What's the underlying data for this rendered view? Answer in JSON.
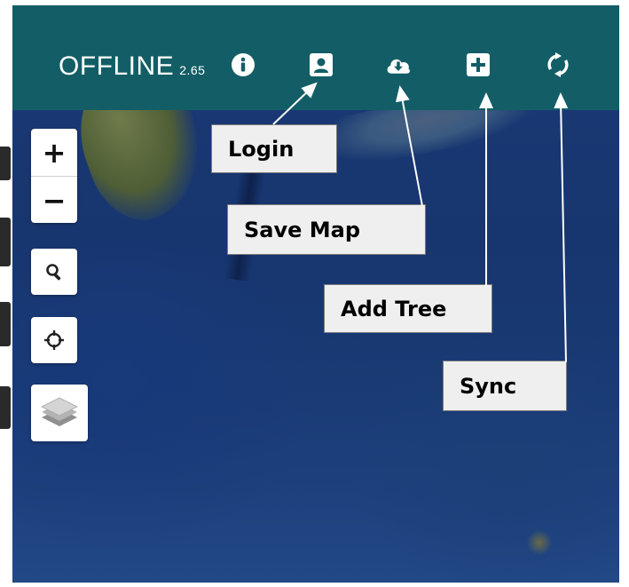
{
  "app": {
    "title": "OFFLINE",
    "version": "2.65"
  },
  "toolbar": {
    "icons": [
      {
        "name": "info-icon",
        "label": "Info"
      },
      {
        "name": "user-icon",
        "label": "Login"
      },
      {
        "name": "cloud-download-icon",
        "label": "Save Map"
      },
      {
        "name": "plus-square-icon",
        "label": "Add Tree"
      },
      {
        "name": "sync-icon",
        "label": "Sync"
      }
    ]
  },
  "map_controls": {
    "zoom_in": "+",
    "zoom_out": "−",
    "search_icon": "search-icon",
    "locate_icon": "crosshair-icon",
    "layers_icon": "layers-icon"
  },
  "callouts": {
    "login": "Login",
    "save_map": "Save Map",
    "add_tree": "Add Tree",
    "sync": "Sync"
  },
  "colors": {
    "topbar": "#135e66",
    "ocean": "#1b3b78",
    "callout_bg": "#efefef"
  }
}
